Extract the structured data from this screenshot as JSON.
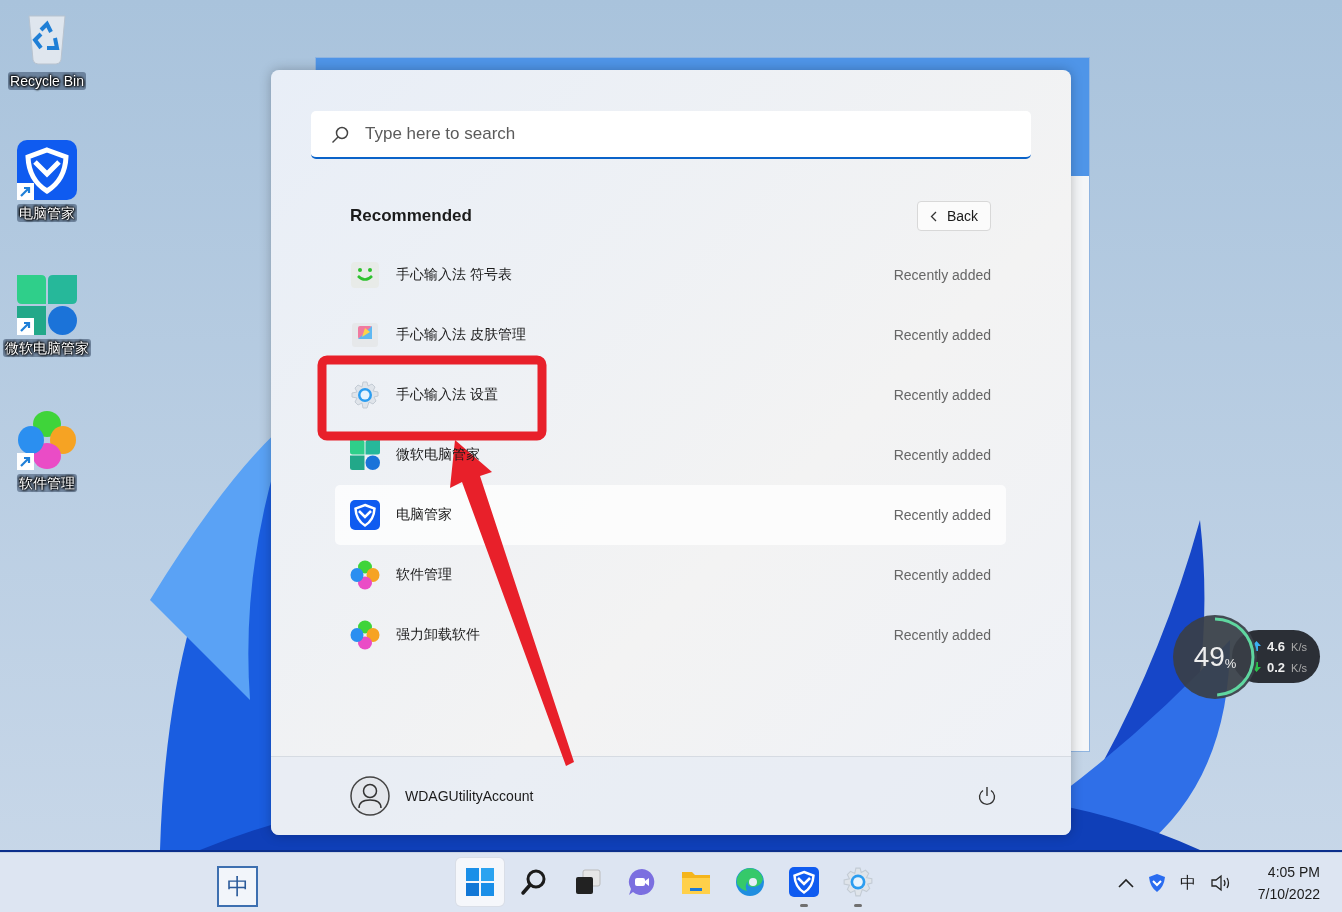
{
  "desktop_icons": [
    {
      "kind": "recycle",
      "label": "Recycle Bin",
      "shortcut": false
    },
    {
      "kind": "shield",
      "label": "电脑管家",
      "shortcut": true
    },
    {
      "kind": "clover",
      "label": "微软电脑管家",
      "shortcut": true
    },
    {
      "kind": "flower",
      "label": "软件管理",
      "shortcut": true
    }
  ],
  "start_menu": {
    "search": {
      "placeholder": "Type here to search"
    },
    "recommended": {
      "title": "Recommended",
      "back_button": "Back",
      "items": [
        {
          "kind": "smiley",
          "name": "手心输入法 符号表",
          "detail": "Recently added",
          "highlighted": false
        },
        {
          "kind": "palette",
          "name": "手心输入法 皮肤管理",
          "detail": "Recently added",
          "highlighted": false
        },
        {
          "kind": "gear",
          "name": "手心输入法 设置",
          "detail": "Recently added",
          "highlighted": false
        },
        {
          "kind": "clover",
          "name": "微软电脑管家",
          "detail": "Recently added",
          "highlighted": false
        },
        {
          "kind": "shield",
          "name": "电脑管家",
          "detail": "Recently added",
          "highlighted": true
        },
        {
          "kind": "flower",
          "name": "软件管理",
          "detail": "Recently added",
          "highlighted": false
        },
        {
          "kind": "flower",
          "name": "强力卸载软件",
          "detail": "Recently added",
          "highlighted": false
        }
      ]
    },
    "user": {
      "name": "WDAGUtilityAccount"
    }
  },
  "speed_widget": {
    "level": 0.49,
    "percent": "49",
    "percent_unit": "%",
    "upload": "4.6",
    "upload_unit": "K/s",
    "download": "0.2",
    "download_unit": "K/s"
  },
  "taskbar": {
    "input_indicator": "中",
    "apps": [
      {
        "kind": "start",
        "selected": true,
        "running": false
      },
      {
        "kind": "search",
        "selected": false,
        "running": false
      },
      {
        "kind": "taskview",
        "selected": false,
        "running": false
      },
      {
        "kind": "chat",
        "selected": false,
        "running": false
      },
      {
        "kind": "folder",
        "selected": false,
        "running": false
      },
      {
        "kind": "edge",
        "selected": false,
        "running": false
      },
      {
        "kind": "shield",
        "selected": false,
        "running": true
      },
      {
        "kind": "gear",
        "selected": false,
        "running": true
      }
    ],
    "tray": {
      "ime": "中",
      "time": "4:05 PM",
      "date": "7/10/2022"
    }
  }
}
